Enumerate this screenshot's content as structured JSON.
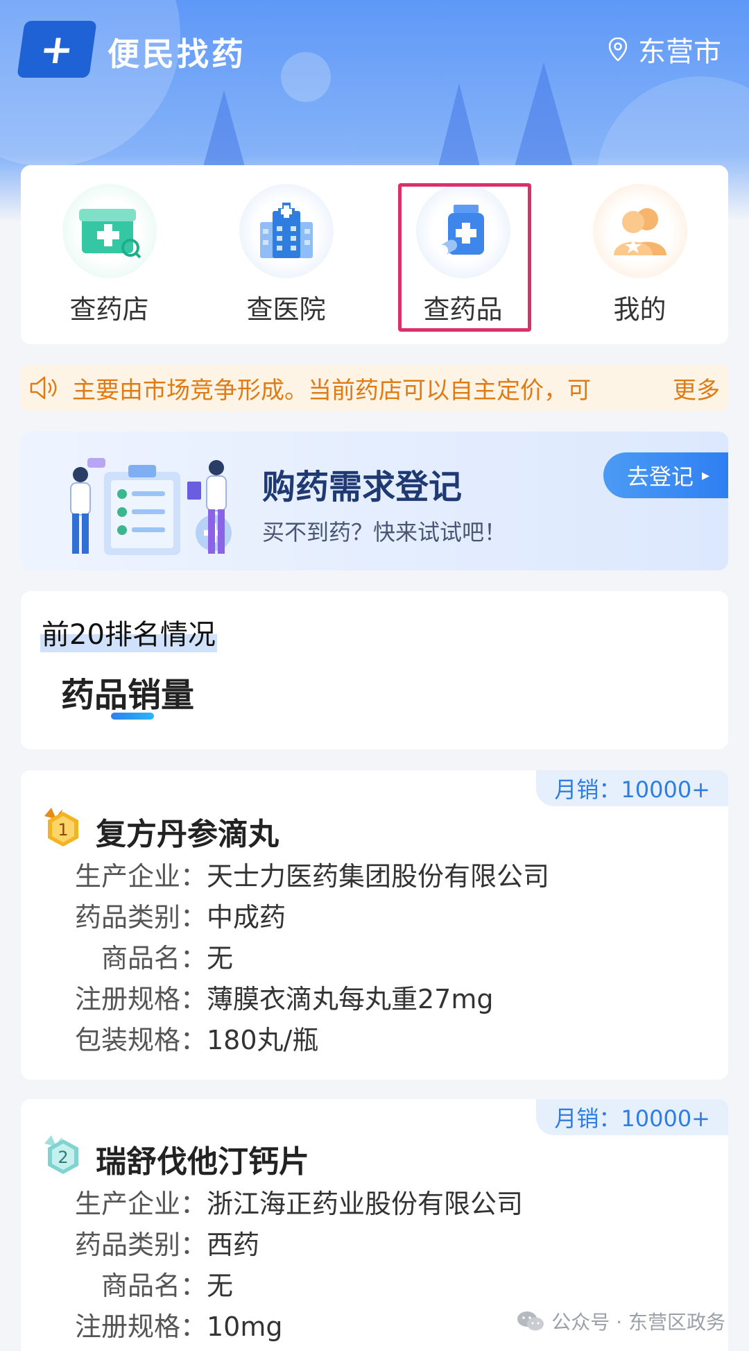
{
  "header": {
    "app_title": "便民找药",
    "city": "东营市"
  },
  "nav": {
    "items": [
      {
        "label": "查药店",
        "icon": "pharmacy-icon"
      },
      {
        "label": "查医院",
        "icon": "hospital-icon"
      },
      {
        "label": "查药品",
        "icon": "medicine-bottle-icon"
      },
      {
        "label": "我的",
        "icon": "user-profile-icon"
      }
    ],
    "highlighted": "查药品"
  },
  "notice": {
    "text": "主要由市场竞争形成。当前药店可以自主定价，可",
    "more": "更多"
  },
  "banner": {
    "title": "购药需求登记",
    "subtitle": "买不到药？快来试试吧！",
    "button": "去登记"
  },
  "ranking": {
    "title": "前20排名情况",
    "tab": "药品销量"
  },
  "drugs": [
    {
      "rank": "1",
      "sales": "月销：10000+",
      "name": "复方丹参滴丸",
      "fields": [
        {
          "k": "生产企业：",
          "v": "天士力医药集团股份有限公司"
        },
        {
          "k": "药品类别：",
          "v": "中成药"
        },
        {
          "k": "商品名：",
          "v": "无"
        },
        {
          "k": "注册规格：",
          "v": "薄膜衣滴丸每丸重27mg"
        },
        {
          "k": "包装规格：",
          "v": "180丸/瓶"
        }
      ],
      "medal_color": "#f3b322"
    },
    {
      "rank": "2",
      "sales": "月销：10000+",
      "name": "瑞舒伐他汀钙片",
      "fields": [
        {
          "k": "生产企业：",
          "v": "浙江海正药业股份有限公司"
        },
        {
          "k": "药品类别：",
          "v": "西药"
        },
        {
          "k": "商品名：",
          "v": "无"
        },
        {
          "k": "注册规格：",
          "v": "10mg"
        }
      ],
      "medal_color": "#7fd3d0"
    }
  ],
  "watermark": "公众号 · 东营区政务",
  "colors": {
    "primary": "#2f7de1",
    "notice_text": "#e07b14",
    "highlight_border": "#d9326a"
  }
}
